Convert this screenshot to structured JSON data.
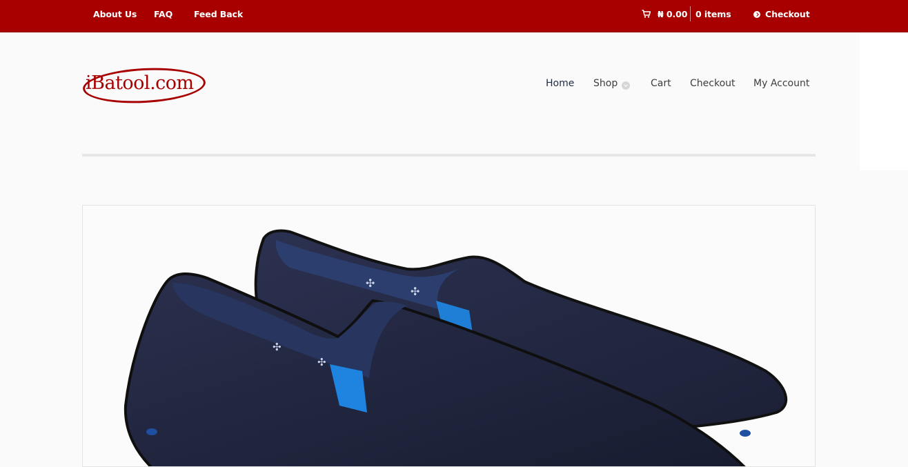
{
  "topbar": {
    "links": [
      "About Us",
      "FAQ",
      "Feed Back"
    ],
    "cart_total": "₦ 0.00",
    "cart_items": "0 items",
    "checkout": "Checkout",
    "background": "#a80000"
  },
  "header": {
    "logo_text": "iBatool.com",
    "nav": [
      "Home",
      "Shop",
      "Cart",
      "Checkout",
      "My Account"
    ],
    "accent": "#a80000"
  },
  "product": {
    "image_alt": "Navy suede slip-on shoes"
  },
  "icons": {
    "cart": "cart-icon",
    "checkout": "arrow-circle-icon",
    "dropdown": "chevron-down-icon"
  }
}
